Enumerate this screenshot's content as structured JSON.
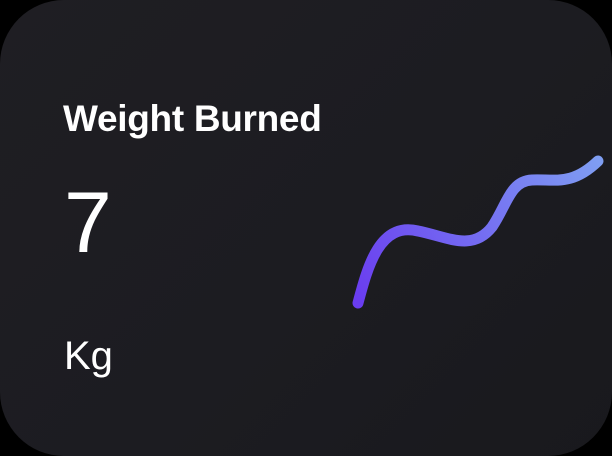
{
  "card": {
    "title": "Weight Burned",
    "value": "7",
    "unit": "Kg",
    "trend_icon": "sparkline-trend-icon",
    "colors": {
      "background": "#1e1d22",
      "text": "#ffffff",
      "line_start": "#6a3df0",
      "line_end": "#7f9ef2"
    }
  }
}
